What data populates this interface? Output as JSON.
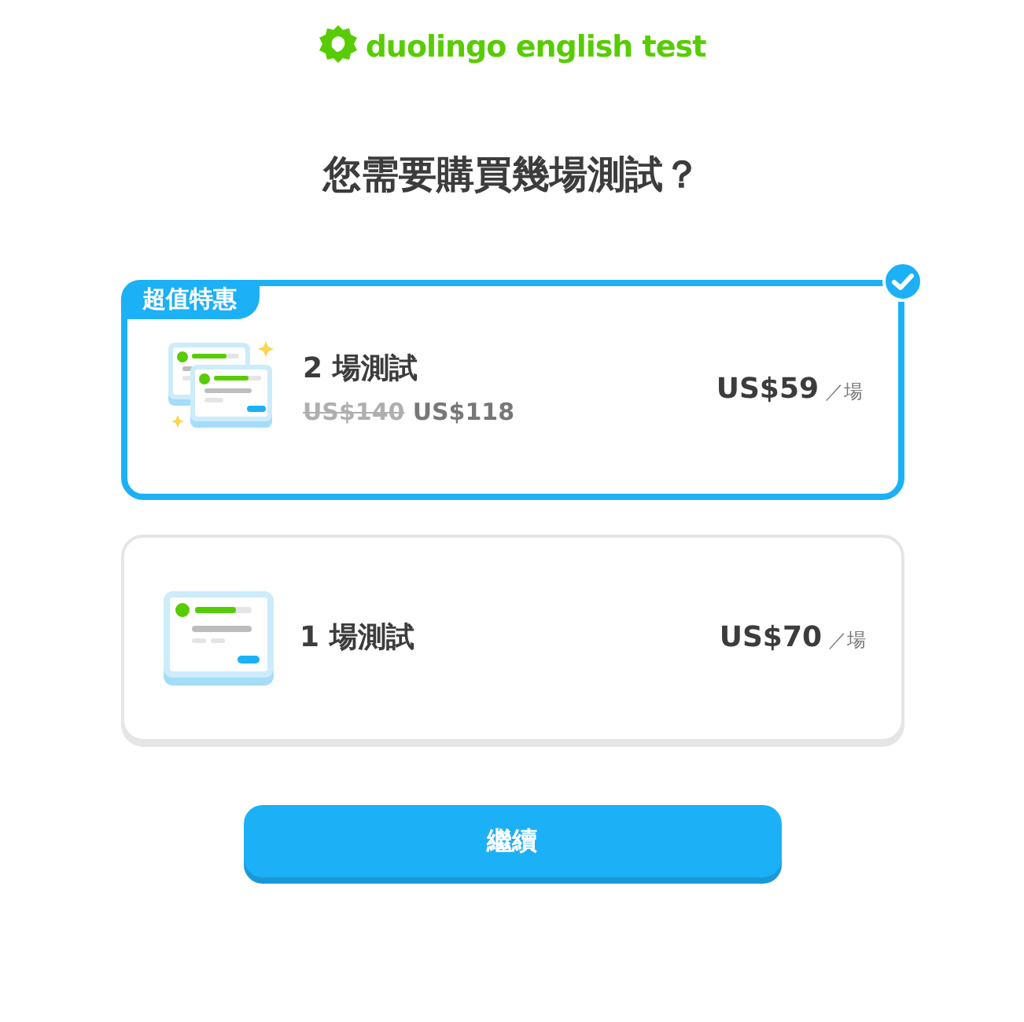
{
  "logo": {
    "text": "duolingo english test"
  },
  "title": "您需要購買幾場測試？",
  "options": [
    {
      "selected": true,
      "badge": "超值特惠",
      "kind": "double",
      "name": "2 場測試",
      "old_price": "US$140",
      "new_price": "US$118",
      "price": "US$59",
      "unit": "／場"
    },
    {
      "selected": false,
      "kind": "single",
      "name": "1 場測試",
      "price": "US$70",
      "unit": "／場"
    }
  ],
  "button": "繼續"
}
